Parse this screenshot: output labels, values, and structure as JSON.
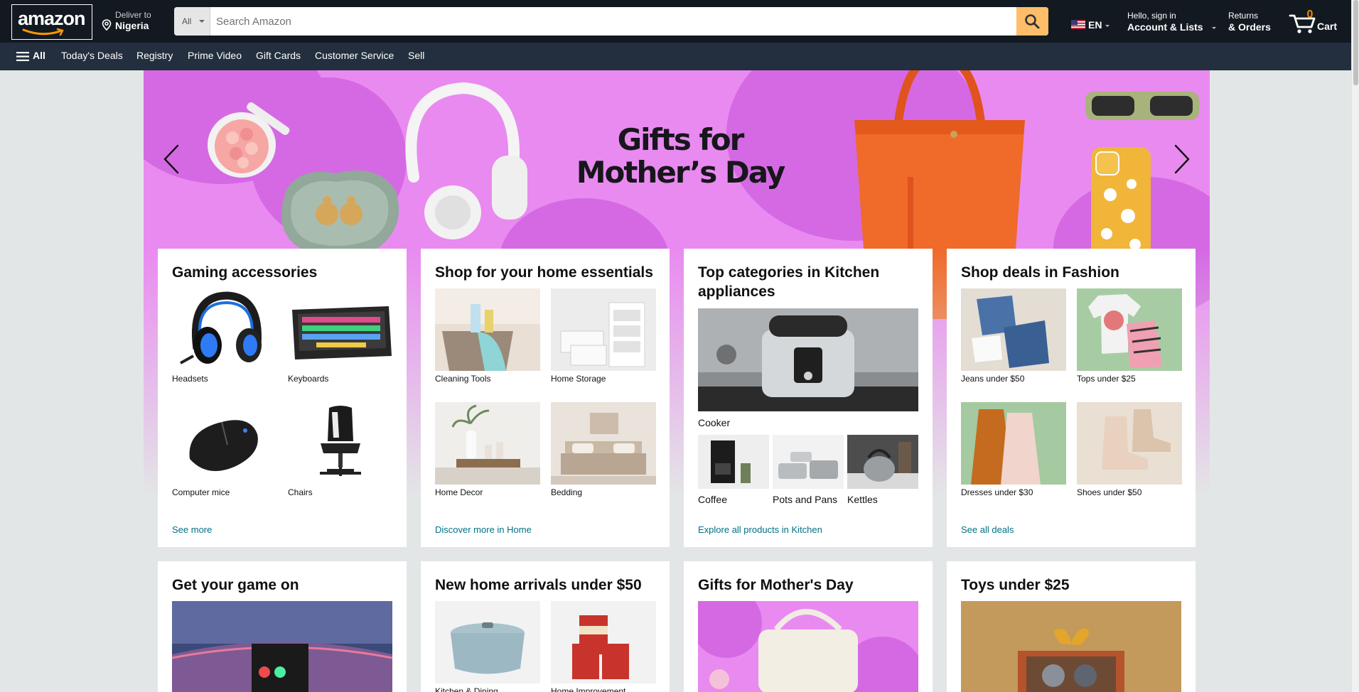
{
  "header": {
    "logo": "amazon",
    "deliver_line1": "Deliver to",
    "deliver_line2": "Nigeria",
    "search_dept": "All",
    "search_placeholder": "Search Amazon",
    "lang": "EN",
    "account_line1": "Hello, sign in",
    "account_line2": "Account & Lists",
    "returns_line1": "Returns",
    "returns_line2": "& Orders",
    "cart_count": "0",
    "cart_label": "Cart",
    "icons": [
      "location-pin-icon",
      "search-icon",
      "us-flag-icon",
      "cart-icon",
      "hamburger-icon"
    ]
  },
  "subnav": {
    "all_label": "All",
    "links": [
      "Today's Deals",
      "Registry",
      "Prime Video",
      "Gift Cards",
      "Customer Service",
      "Sell"
    ]
  },
  "hero": {
    "title_line1": "Gifts for",
    "title_line2": "Mother’s Day",
    "colors": {
      "background": "#e98af0",
      "blob": "#d569e3"
    }
  },
  "cards": [
    {
      "title": "Gaming accessories",
      "items": [
        "Headsets",
        "Keyboards",
        "Computer mice",
        "Chairs"
      ],
      "link": "See more"
    },
    {
      "title": "Shop for your home essentials",
      "items": [
        "Cleaning Tools",
        "Home Storage",
        "Home Decor",
        "Bedding"
      ],
      "link": "Discover more in Home"
    },
    {
      "title": "Top categories in Kitchen appliances",
      "main_item": "Cooker",
      "items": [
        "Coffee",
        "Pots and Pans",
        "Kettles"
      ],
      "link": "Explore all products in Kitchen"
    },
    {
      "title": "Shop deals in Fashion",
      "items": [
        "Jeans under $50",
        "Tops under $25",
        "Dresses under $30",
        "Shoes under $50"
      ],
      "link": "See all deals"
    }
  ],
  "cards_row2": [
    {
      "title": "Get your game on"
    },
    {
      "title": "New home arrivals under $50",
      "items": [
        "Kitchen & Dining",
        "Home Improvement"
      ]
    },
    {
      "title": "Gifts for Mother's Day"
    },
    {
      "title": "Toys under $25"
    }
  ],
  "colors": {
    "nav_dark": "#131921",
    "nav_sub": "#232f3e",
    "search_button": "#febd69",
    "link": "#007185",
    "cart_count": "#f08804"
  }
}
